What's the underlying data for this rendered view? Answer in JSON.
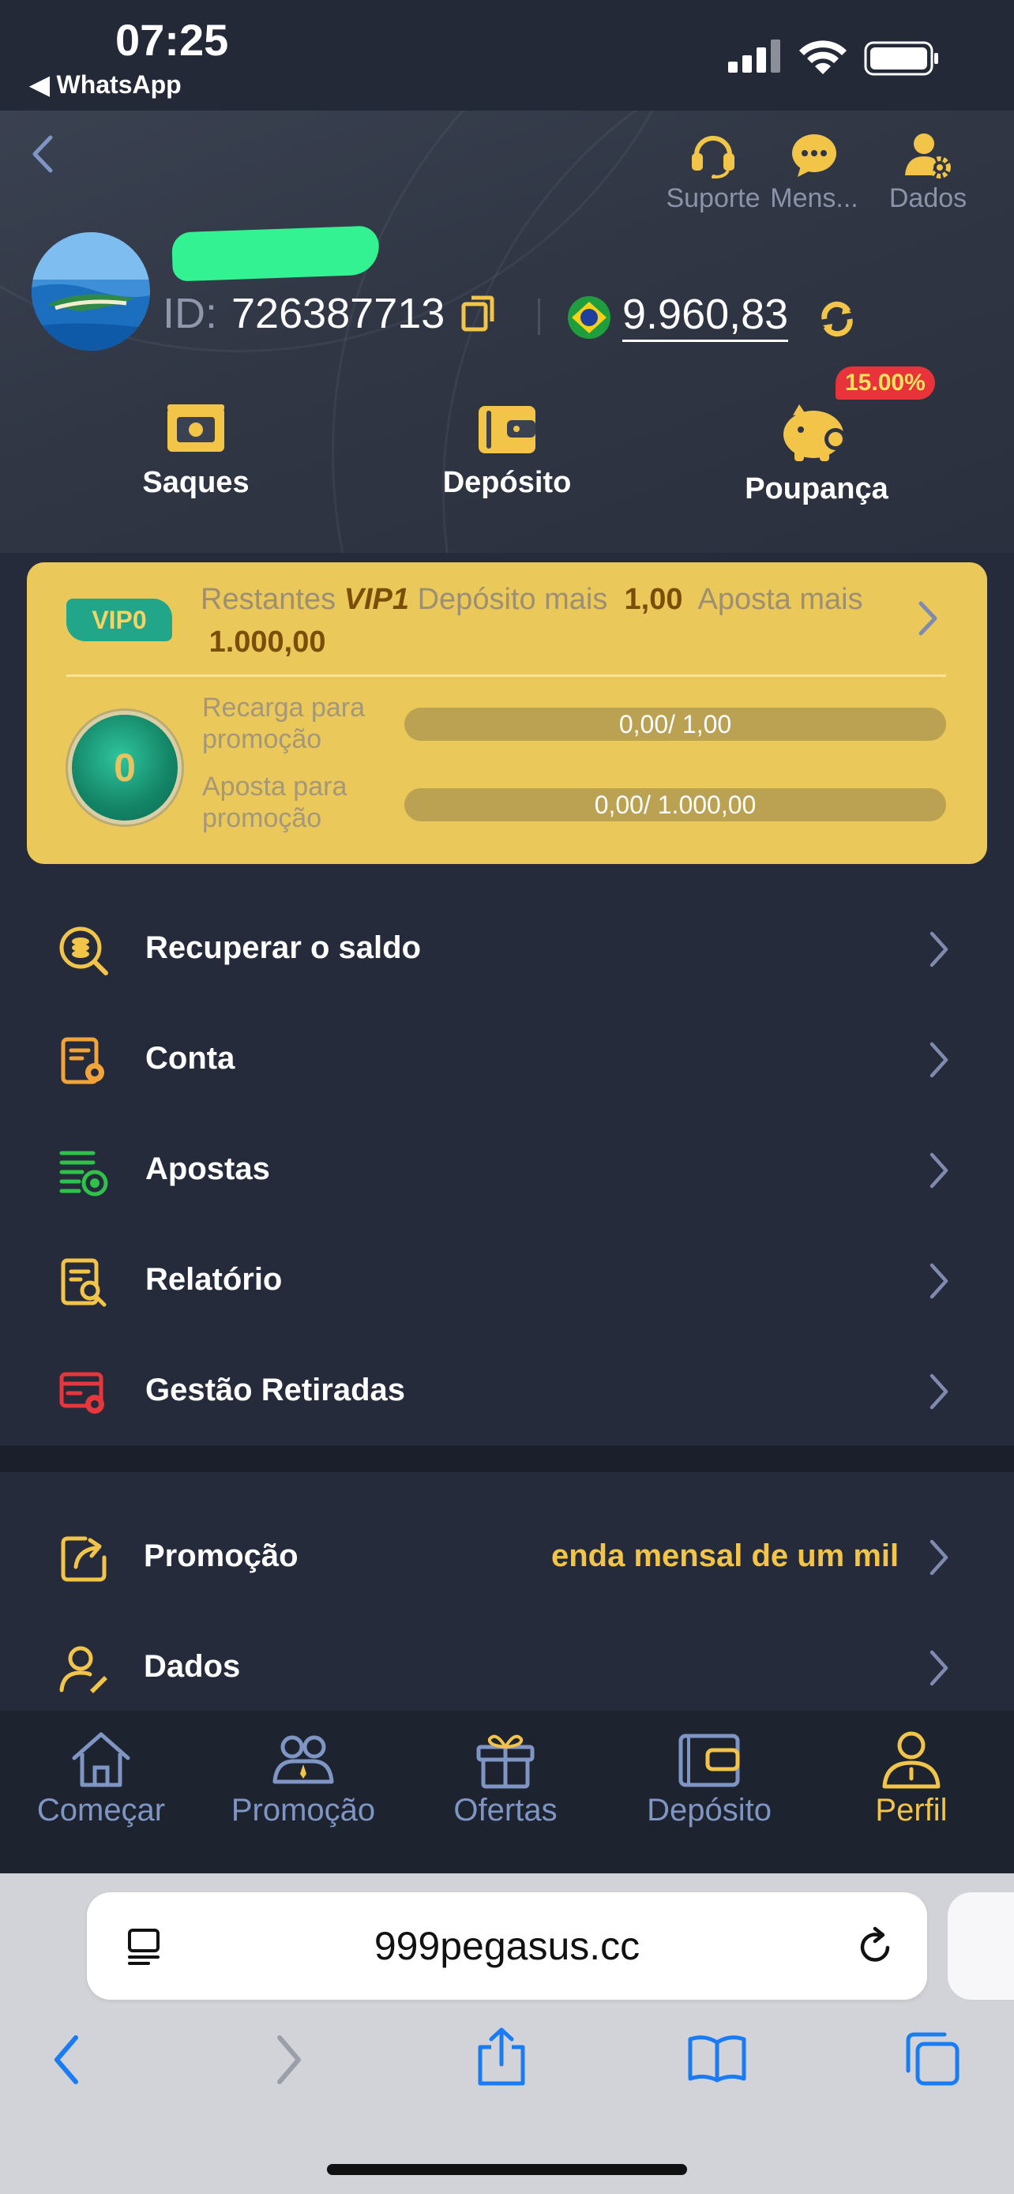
{
  "status_bar": {
    "time": "07:25",
    "back_app": "◀ WhatsApp"
  },
  "header": {
    "top_actions": [
      {
        "label": "Suporte",
        "icon": "headset-icon"
      },
      {
        "label": "Mens...",
        "icon": "chat-bubble-icon"
      },
      {
        "label": "Dados",
        "icon": "user-gear-icon"
      }
    ],
    "id_label": "ID:",
    "id_value": "726387713",
    "balance": "9.960,83",
    "quick_actions": [
      {
        "label": "Saques",
        "icon": "cash-icon"
      },
      {
        "label": "Depósito",
        "icon": "wallet-icon"
      },
      {
        "label": "Poupança",
        "icon": "piggy-bank-icon"
      }
    ],
    "savings_rate": "15.00%"
  },
  "vip": {
    "badge": "VIP0",
    "remaining_label": "Restantes",
    "next_level": "VIP1",
    "deposit_label": "Depósito mais",
    "deposit_value": "1,00",
    "bet_label": "Aposta",
    "bet_more_label": "mais",
    "bet_value": "1.000,00",
    "coin_level": "0",
    "progress": [
      {
        "label": "Recarga para promoção",
        "text": "0,00/ 1,00",
        "fraction": 0
      },
      {
        "label": "Aposta para promoção",
        "text": "0,00/ 1.000,00",
        "fraction": 0
      }
    ]
  },
  "menu": [
    {
      "label": "Recuperar o saldo",
      "icon": "recover-balance-icon",
      "color": "#f2c548"
    },
    {
      "label": "Conta",
      "icon": "account-statement-icon",
      "color": "#f2a33a"
    },
    {
      "label": "Apostas",
      "icon": "bets-list-icon",
      "color": "#2fc24a"
    },
    {
      "label": "Relatório",
      "icon": "report-search-icon",
      "color": "#f2c548"
    },
    {
      "label": "Gestão Retiradas",
      "icon": "withdraw-card-icon",
      "color": "#e5373c"
    }
  ],
  "menu2": [
    {
      "label": "Promoção",
      "icon": "share-icon",
      "marquee": "enda mensal de um mil"
    },
    {
      "label": "Dados",
      "icon": "user-edit-icon"
    }
  ],
  "tabs": [
    {
      "label": "Começar",
      "icon": "home-icon"
    },
    {
      "label": "Promoção",
      "icon": "people-icon"
    },
    {
      "label": "Ofertas",
      "icon": "gift-icon"
    },
    {
      "label": "Depósito",
      "icon": "wallet-icon"
    },
    {
      "label": "Perfil",
      "icon": "profile-icon",
      "active": true
    }
  ],
  "browser": {
    "url": "999pegasus.cc"
  },
  "colors": {
    "accent": "#f2c548",
    "vip_card": "#ebc85a",
    "background": "#252b3a"
  }
}
